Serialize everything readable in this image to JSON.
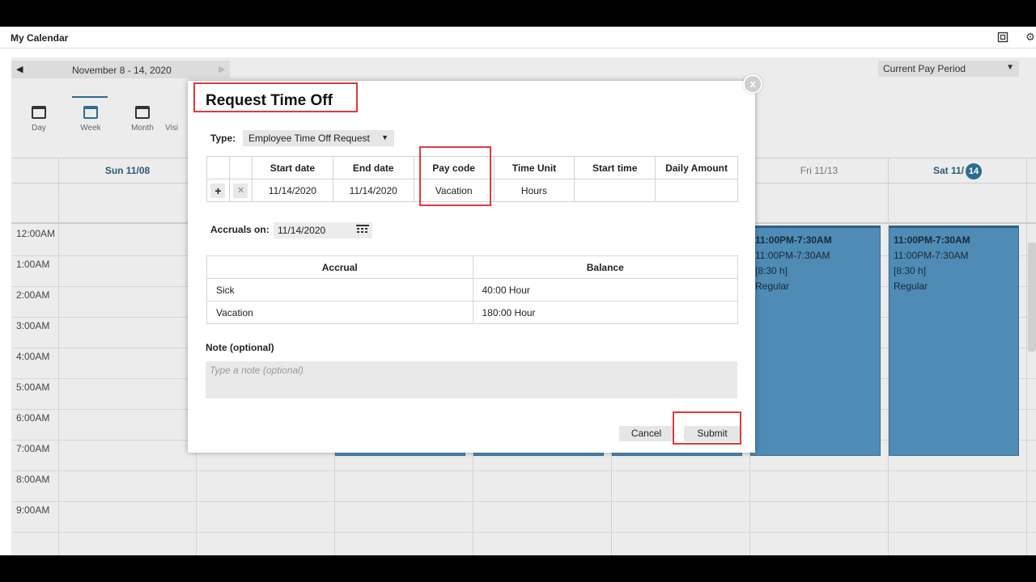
{
  "app": {
    "title": "My Calendar"
  },
  "nav": {
    "range": "November 8 - 14, 2020",
    "period": "Current Pay Period"
  },
  "views": [
    {
      "label": "Day"
    },
    {
      "label": "Week"
    },
    {
      "label": "Month"
    },
    {
      "label": "Visi"
    }
  ],
  "days": {
    "sun": "Sun 11/08",
    "fri": "Fri 11/13",
    "sat": "Sat 11/",
    "sat_badge": "14"
  },
  "hours": [
    "12:00AM",
    "1:00AM",
    "2:00AM",
    "3:00AM",
    "4:00AM",
    "5:00AM",
    "6:00AM",
    "7:00AM",
    "8:00AM",
    "9:00AM"
  ],
  "shifts": {
    "fri": {
      "line1": "11:00PM-7:30AM",
      "line2": "11:00PM-7:30AM",
      "line3": "[8:30 h]",
      "line4": "Regular"
    },
    "sat": {
      "line1": "11:00PM-7:30AM",
      "line2": "11:00PM-7:30AM",
      "line3": "[8:30 h]",
      "line4": "Regular"
    }
  },
  "dialog": {
    "title": "Request Time Off",
    "type_label": "Type:",
    "type_value": "Employee Time Off Request",
    "request_table": {
      "headers": [
        "Start date",
        "End date",
        "Pay code",
        "Time Unit",
        "Start time",
        "Daily Amount"
      ],
      "row": {
        "start_date": "11/14/2020",
        "end_date": "11/14/2020",
        "pay_code": "Vacation",
        "time_unit": "Hours",
        "start_time": "",
        "daily_amount": ""
      }
    },
    "accruals_label": "Accruals on:",
    "accruals_date": "11/14/2020",
    "accrual_table": {
      "headers": [
        "Accrual",
        "Balance"
      ],
      "rows": [
        {
          "accrual": "Sick",
          "balance": "40:00 Hour"
        },
        {
          "accrual": "Vacation",
          "balance": "180:00 Hour"
        }
      ]
    },
    "note_label": "Note (optional)",
    "note_placeholder": "Type a note (optional)",
    "cancel_label": "Cancel",
    "submit_label": "Submit",
    "close_label": "x"
  },
  "colors": {
    "accent": "#2a6f8e",
    "shift_fill": "#4e8bb5",
    "highlight": "#e0393e"
  }
}
